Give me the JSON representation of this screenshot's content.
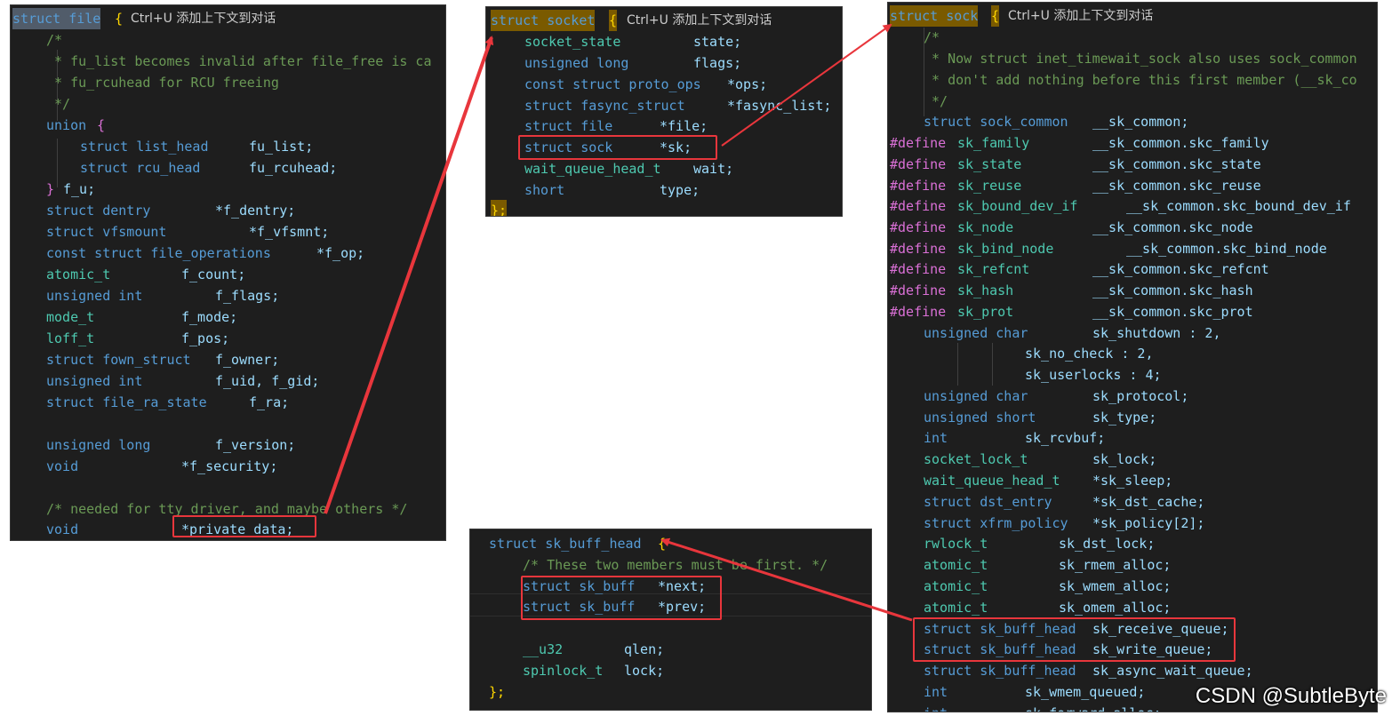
{
  "hint": "Ctrl+U 添加上下文到对话",
  "file_panel": {
    "l0": {
      "a": "struct file",
      "b": "{"
    },
    "l1": "/*",
    "l2": " * fu_list becomes invalid after file_free is ca",
    "l3": " * fu_rcuhead for RCU freeing",
    "l4": " */",
    "l5": {
      "a": "union",
      "b": "{"
    },
    "l6": {
      "a": "struct list_head",
      "b": "fu_list;"
    },
    "l7": {
      "a": "struct rcu_head",
      "b": "fu_rcuhead;"
    },
    "l8": {
      "a": "}",
      "b": "f_u;"
    },
    "l9": {
      "a": "struct dentry",
      "b": "*f_dentry;"
    },
    "l10": {
      "a": "struct vfsmount",
      "b": "*f_vfsmnt;"
    },
    "l11": {
      "a": "const struct file_operations",
      "b": "*f_op;"
    },
    "l12": {
      "a": "atomic_t",
      "b": "f_count;"
    },
    "l13": {
      "a": "unsigned int",
      "b": "f_flags;"
    },
    "l14": {
      "a": "mode_t",
      "b": "f_mode;"
    },
    "l15": {
      "a": "loff_t",
      "b": "f_pos;"
    },
    "l16": {
      "a": "struct fown_struct",
      "b": "f_owner;"
    },
    "l17": {
      "a": "unsigned int",
      "b": "f_uid, f_gid;"
    },
    "l18": {
      "a": "struct file_ra_state",
      "b": "f_ra;"
    },
    "l19": {
      "a": "unsigned long",
      "b": "f_version;"
    },
    "l20": {
      "a": "void",
      "b": "*f_security;"
    },
    "l21": "/* needed for tty driver, and maybe others */",
    "l22": {
      "a": "void",
      "b": "*private_data;"
    }
  },
  "socket_panel": {
    "l0": {
      "a": "struct socket",
      "b": "{"
    },
    "l1": {
      "a": "socket_state",
      "b": "state;"
    },
    "l2": {
      "a": "unsigned long",
      "b": "flags;"
    },
    "l3": {
      "a": "const struct proto_ops",
      "b": "*ops;"
    },
    "l4": {
      "a": "struct fasync_struct",
      "b": "*fasync_list;"
    },
    "l5": {
      "a": "struct file",
      "b": "*file;"
    },
    "l6": {
      "a": "struct sock",
      "b": "*sk;"
    },
    "l7": {
      "a": "wait_queue_head_t",
      "b": "wait;"
    },
    "l8": {
      "a": "short",
      "b": "type;"
    },
    "l9": "};"
  },
  "skb_panel": {
    "l0": {
      "a": "struct sk_buff_head",
      "b": "{"
    },
    "l1": "/* These two members must be first. */",
    "l2": {
      "a": "struct sk_buff",
      "b": "*next;"
    },
    "l3": {
      "a": "struct sk_buff",
      "b": "*prev;"
    },
    "l4": {
      "a": "__u32",
      "b": "qlen;"
    },
    "l5": {
      "a": "spinlock_t",
      "b": "lock;"
    },
    "l6": "};"
  },
  "sock_panel": {
    "l0": {
      "a": "struct sock",
      "b": "{"
    },
    "l1": "/*",
    "l2": " * Now struct inet_timewait_sock also uses sock_common",
    "l3": " * don't add nothing before this first member (__sk_co",
    "l4": " */",
    "l5": {
      "a": "struct sock_common",
      "b": "__sk_common;"
    },
    "l6": {
      "a": "sk_family",
      "b": "__sk_common.skc_family"
    },
    "l7": {
      "a": "sk_state",
      "b": "__sk_common.skc_state"
    },
    "l8": {
      "a": "sk_reuse",
      "b": "__sk_common.skc_reuse"
    },
    "l9": {
      "a": "sk_bound_dev_if",
      "b": "__sk_common.skc_bound_dev_if"
    },
    "l10": {
      "a": "sk_node",
      "b": "__sk_common.skc_node"
    },
    "l11": {
      "a": "sk_bind_node",
      "b": "__sk_common.skc_bind_node"
    },
    "l12": {
      "a": "sk_refcnt",
      "b": "__sk_common.skc_refcnt"
    },
    "l13": {
      "a": "sk_hash",
      "b": "__sk_common.skc_hash"
    },
    "l14": {
      "a": "sk_prot",
      "b": "__sk_common.skc_prot"
    },
    "define_kw": "#define",
    "l15": {
      "a": "unsigned char",
      "b": "sk_shutdown : 2,"
    },
    "l16": "sk_no_check : 2,",
    "l17": "sk_userlocks : 4;",
    "l18": {
      "a": "unsigned char",
      "b": "sk_protocol;"
    },
    "l19": {
      "a": "unsigned short",
      "b": "sk_type;"
    },
    "l20": {
      "a": "int",
      "b": "sk_rcvbuf;"
    },
    "l21": {
      "a": "socket_lock_t",
      "b": "sk_lock;"
    },
    "l22": {
      "a": "wait_queue_head_t",
      "b": "*sk_sleep;"
    },
    "l23": {
      "a": "struct dst_entry",
      "b": "*sk_dst_cache;"
    },
    "l24": {
      "a": "struct xfrm_policy",
      "b": "*sk_policy[2];"
    },
    "l25": {
      "a": "rwlock_t",
      "b": "sk_dst_lock;"
    },
    "l26": {
      "a": "atomic_t",
      "b": "sk_rmem_alloc;"
    },
    "l27": {
      "a": "atomic_t",
      "b": "sk_wmem_alloc;"
    },
    "l28": {
      "a": "atomic_t",
      "b": "sk_omem_alloc;"
    },
    "l29": {
      "a": "struct sk_buff_head",
      "b": "sk_receive_queue;"
    },
    "l30": {
      "a": "struct sk_buff_head",
      "b": "sk_write_queue;"
    },
    "l31": {
      "a": "struct sk_buff_head",
      "b": "sk_async_wait_queue;"
    },
    "l32": {
      "a": "int",
      "b": "sk_wmem_queued;"
    },
    "l33": {
      "a": "int",
      "b": "sk_forward_alloc;"
    }
  },
  "watermark": "CSDN @SubtleByte",
  "colors": {
    "arrow": "#e8363c",
    "background": "#1e1e1e",
    "keyword": "#569cd6",
    "type": "#4ec9b0",
    "comment": "#6a9955"
  }
}
